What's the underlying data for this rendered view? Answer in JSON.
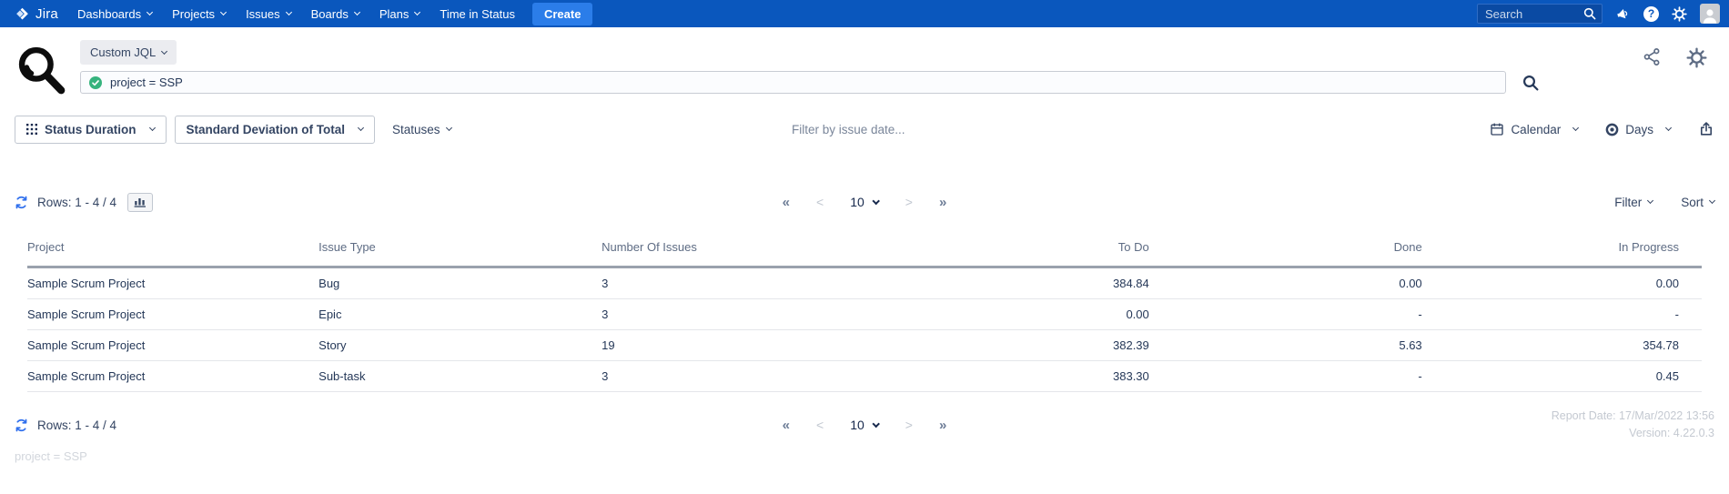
{
  "nav": {
    "brand": "Jira",
    "items": [
      {
        "label": "Dashboards"
      },
      {
        "label": "Projects"
      },
      {
        "label": "Issues"
      },
      {
        "label": "Boards"
      },
      {
        "label": "Plans"
      },
      {
        "label": "Time in Status"
      }
    ],
    "create_label": "Create",
    "search_placeholder": "Search",
    "help_glyph": "?"
  },
  "header": {
    "mode_label": "Custom JQL",
    "jql_value": "project = SSP"
  },
  "toolbar": {
    "report_type_label": "Status Duration",
    "calculation_label": "Standard Deviation of Total",
    "statuses_label": "Statuses",
    "date_filter_placeholder": "Filter by issue date...",
    "calendar_label": "Calendar",
    "time_unit_label": "Days"
  },
  "results": {
    "rows_label": "Rows: 1 - 4 / 4",
    "pagination": {
      "first": "«",
      "prev": "<",
      "page_size": "10",
      "next": ">",
      "last": "»"
    },
    "filter_label": "Filter",
    "sort_label": "Sort"
  },
  "table": {
    "columns": [
      "Project",
      "Issue Type",
      "Number Of Issues",
      "To Do",
      "Done",
      "In Progress"
    ],
    "rows": [
      [
        "Sample Scrum Project",
        "Bug",
        "3",
        "384.84",
        "0.00",
        "0.00"
      ],
      [
        "Sample Scrum Project",
        "Epic",
        "3",
        "0.00",
        "-",
        "-"
      ],
      [
        "Sample Scrum Project",
        "Story",
        "19",
        "382.39",
        "5.63",
        "354.78"
      ],
      [
        "Sample Scrum Project",
        "Sub-task",
        "3",
        "383.30",
        "-",
        "0.45"
      ]
    ]
  },
  "footer": {
    "rows_label": "Rows: 1 - 4 / 4",
    "report_date": "Report Date: 17/Mar/2022 13:56",
    "version": "Version: 4.22.0.3",
    "jql_echo": "project = SSP"
  },
  "colors": {
    "nav_bg": "#0a57bd",
    "create_bg": "#2b7de9",
    "text_dark": "#344563",
    "muted_gray": "#5e6c84",
    "success_green": "#36b37e",
    "refresh_blue": "#2f6fed",
    "faint_gray": "#c4c9d1"
  }
}
